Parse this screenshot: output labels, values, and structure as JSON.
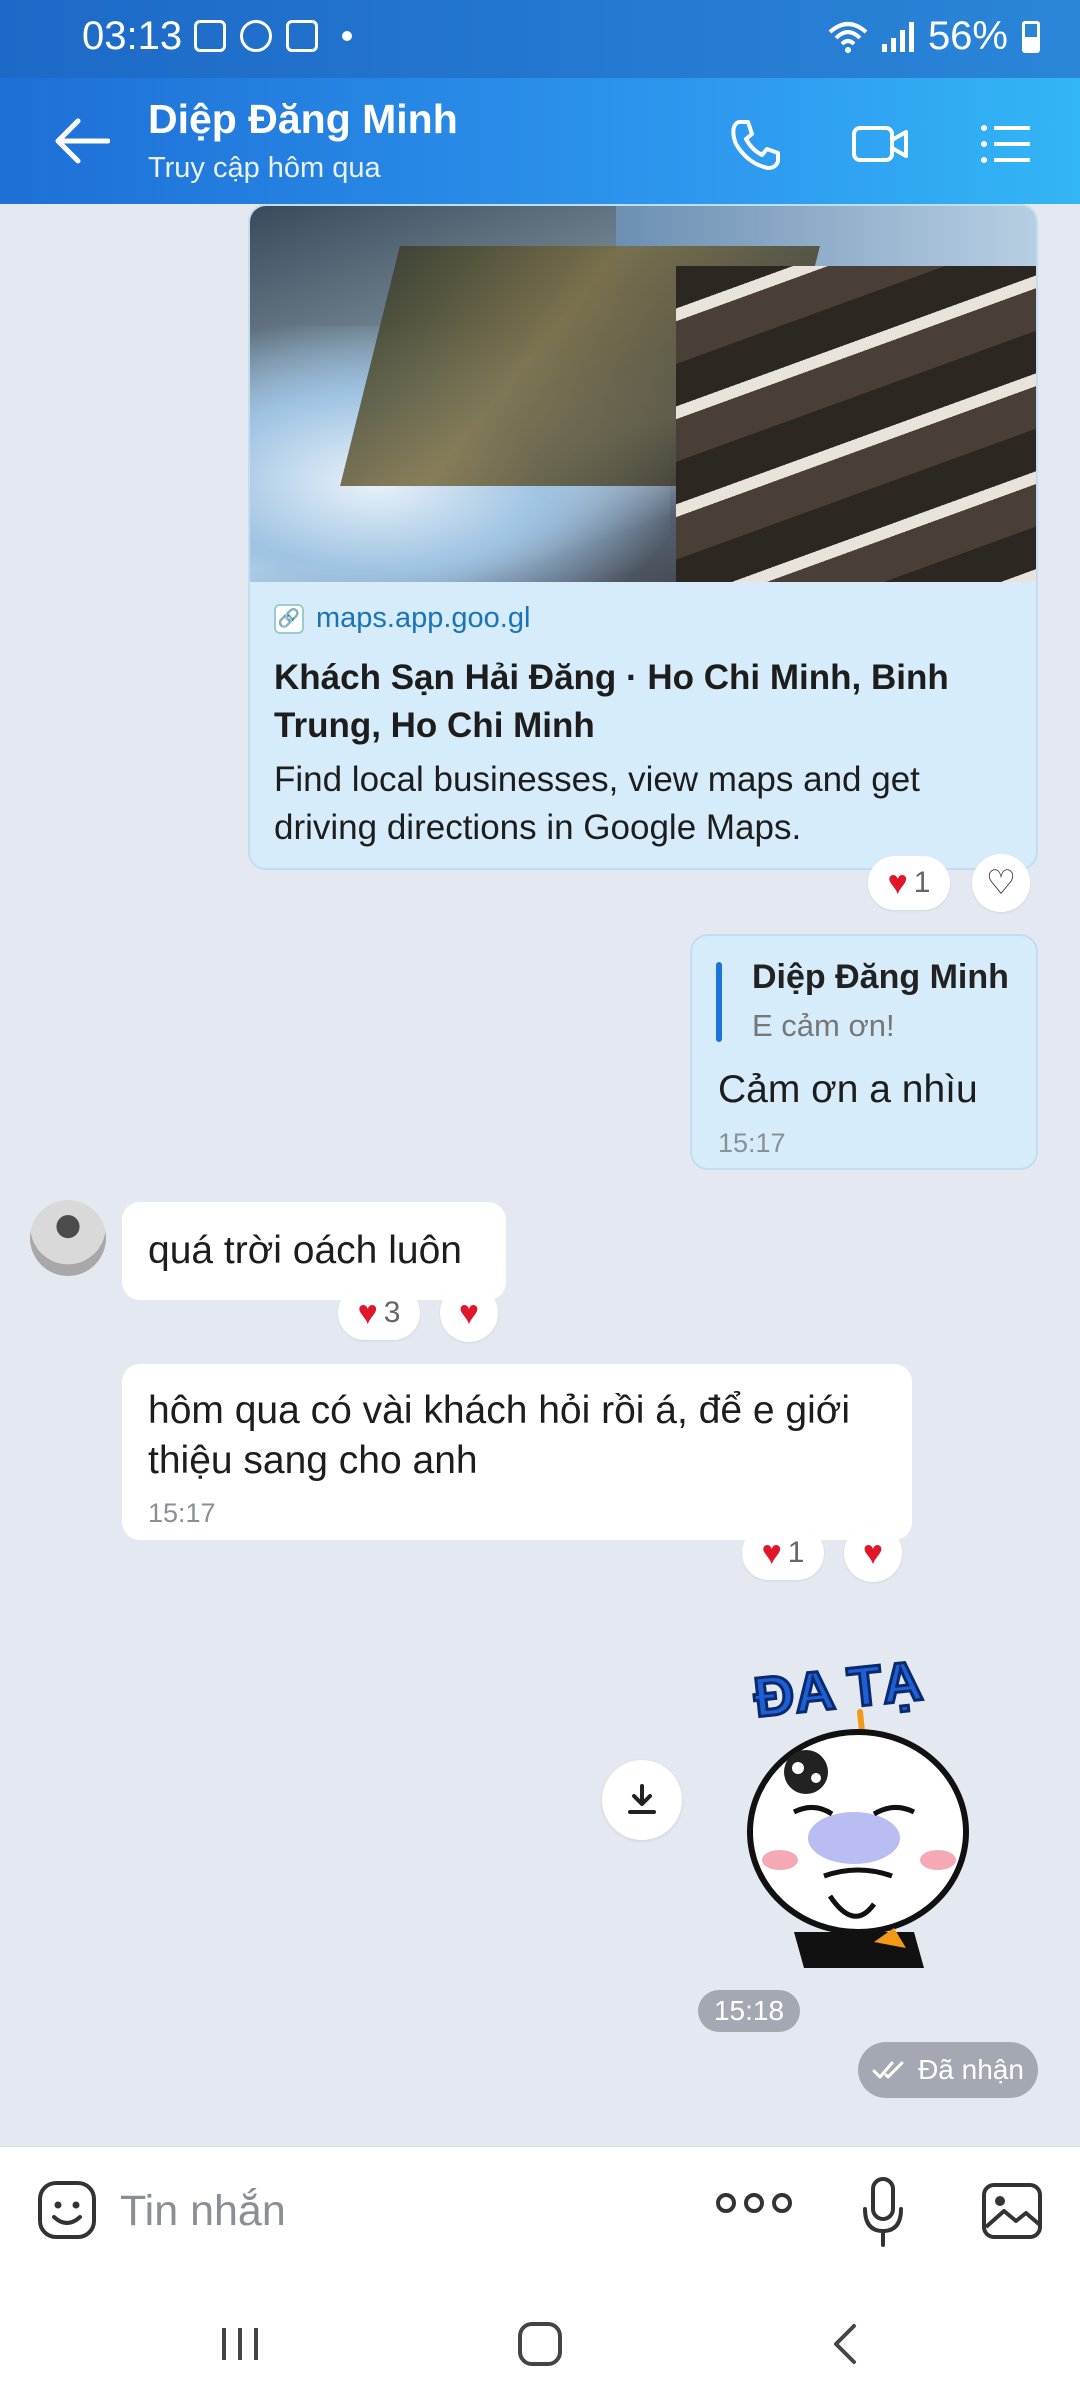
{
  "status_bar": {
    "time": "03:13",
    "battery": "56%"
  },
  "header": {
    "contact_name": "Diệp Đăng Minh",
    "last_seen": "Truy cập hôm qua"
  },
  "link_preview": {
    "domain": "maps.app.goo.gl",
    "title": "Khách Sạn Hải Đăng · Ho Chi Minh, Binh Trung, Ho Chi Minh",
    "description": "Find local businesses, view maps and get driving directions in Google Maps.",
    "reaction_count": "1"
  },
  "my_reply": {
    "quote_name": "Diệp Đăng Minh",
    "quote_text": "E cảm ơn!",
    "text": "Cảm ơn a nhìu",
    "time": "15:17"
  },
  "their_msg1": {
    "text": "quá trời oách luôn",
    "reaction_count": "3"
  },
  "their_msg2": {
    "text": "hôm qua có vài khách hỏi rồi á, để e giới thiệu sang cho anh",
    "time": "15:17",
    "reaction_count": "1"
  },
  "sticker": {
    "time": "15:18",
    "caption": "ĐA TẠ"
  },
  "delivery_status": "Đã nhận",
  "composer": {
    "placeholder": "Tin nhắn"
  }
}
